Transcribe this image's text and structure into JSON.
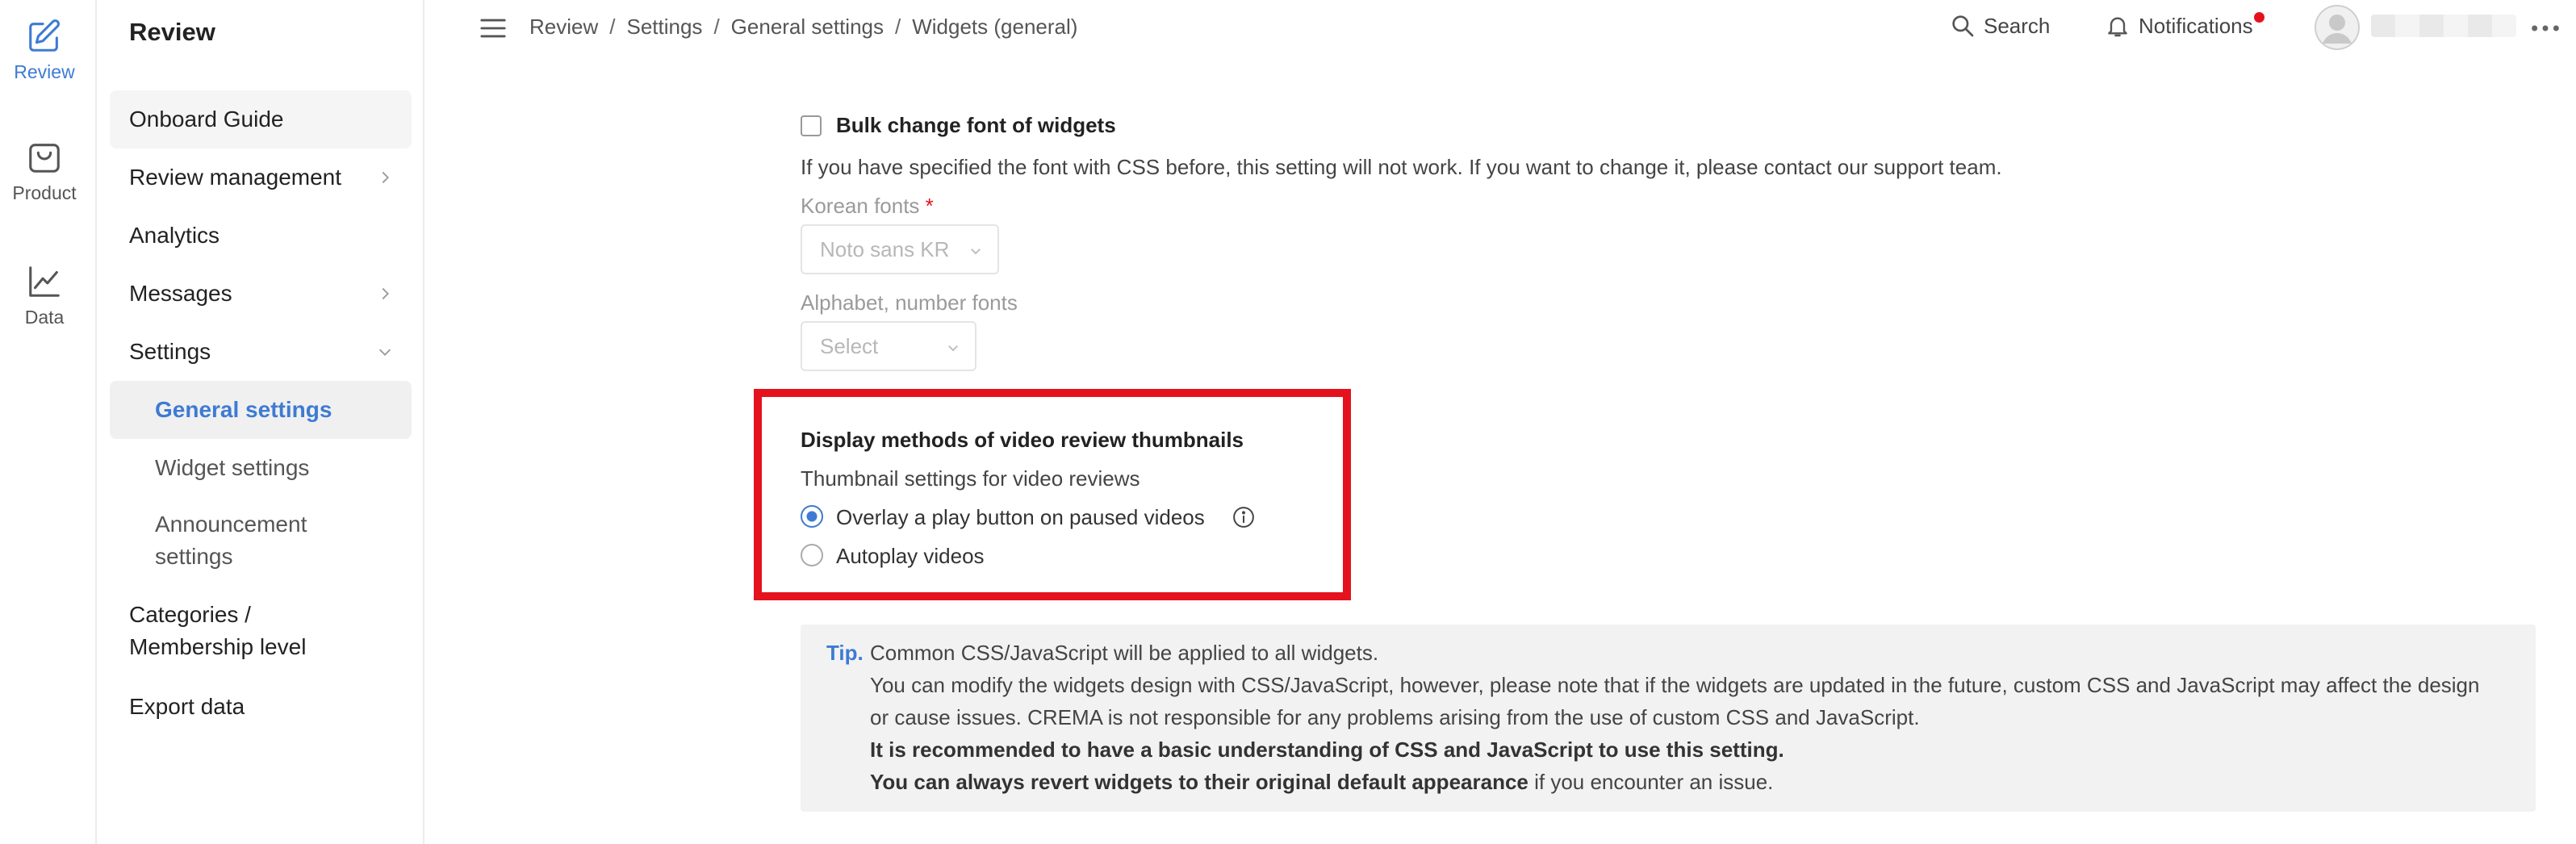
{
  "rail": {
    "items": [
      {
        "label": "Review",
        "icon": "edit-icon",
        "active": true
      },
      {
        "label": "Product",
        "icon": "bag-icon",
        "active": false
      },
      {
        "label": "Data",
        "icon": "chart-line-icon",
        "active": false
      }
    ],
    "accent": "#3d7bd3"
  },
  "sidebar": {
    "title": "Review",
    "items": [
      {
        "label": "Onboard Guide"
      },
      {
        "label": "Review management"
      },
      {
        "label": "Analytics"
      },
      {
        "label": "Messages"
      },
      {
        "label": "Settings"
      },
      {
        "label": "General settings"
      },
      {
        "label": "Widget settings"
      },
      {
        "label": "Announcement settings"
      },
      {
        "label": "Categories / Membership level"
      },
      {
        "label": "Export data"
      }
    ]
  },
  "topbar": {
    "breadcrumb": [
      "Review",
      "Settings",
      "General settings",
      "Widgets (general)"
    ],
    "separator": "/",
    "search_label": "Search",
    "notifications_label": "Notifications",
    "notification_dot_color": "#e4121d"
  },
  "font_section": {
    "checkbox_label": "Bulk change font of widgets",
    "description": "If you have specified the font with CSS before, this setting will not work. If you want to change it, please contact our support team.",
    "korean_label": "Korean fonts",
    "required_mark": "*",
    "korean_value": "Noto sans KR",
    "alphabet_label": "Alphabet, number fonts",
    "alphabet_placeholder": "Select"
  },
  "video_section": {
    "title": "Display methods of video review thumbnails",
    "subtitle": "Thumbnail settings for video reviews",
    "options": [
      {
        "label": "Overlay a play button on paused videos",
        "selected": true
      },
      {
        "label": "Autoplay videos",
        "selected": false
      }
    ],
    "highlight_color": "#e4121d"
  },
  "tip": {
    "label": "Tip.",
    "lines": [
      "Common CSS/JavaScript will be applied to all widgets.",
      "You can modify the widgets design with CSS/JavaScript, however, please note that if the widgets are updated in the future, custom CSS and JavaScript may affect the design",
      "or cause issues. CREMA is not responsible for any problems arising from the use of custom CSS and JavaScript.",
      "It is recommended to have a basic understanding of CSS and JavaScript to use this setting."
    ],
    "last_line_bold": "You can always revert widgets to their original default appearance",
    "last_line_rest": " if you encounter an issue."
  }
}
